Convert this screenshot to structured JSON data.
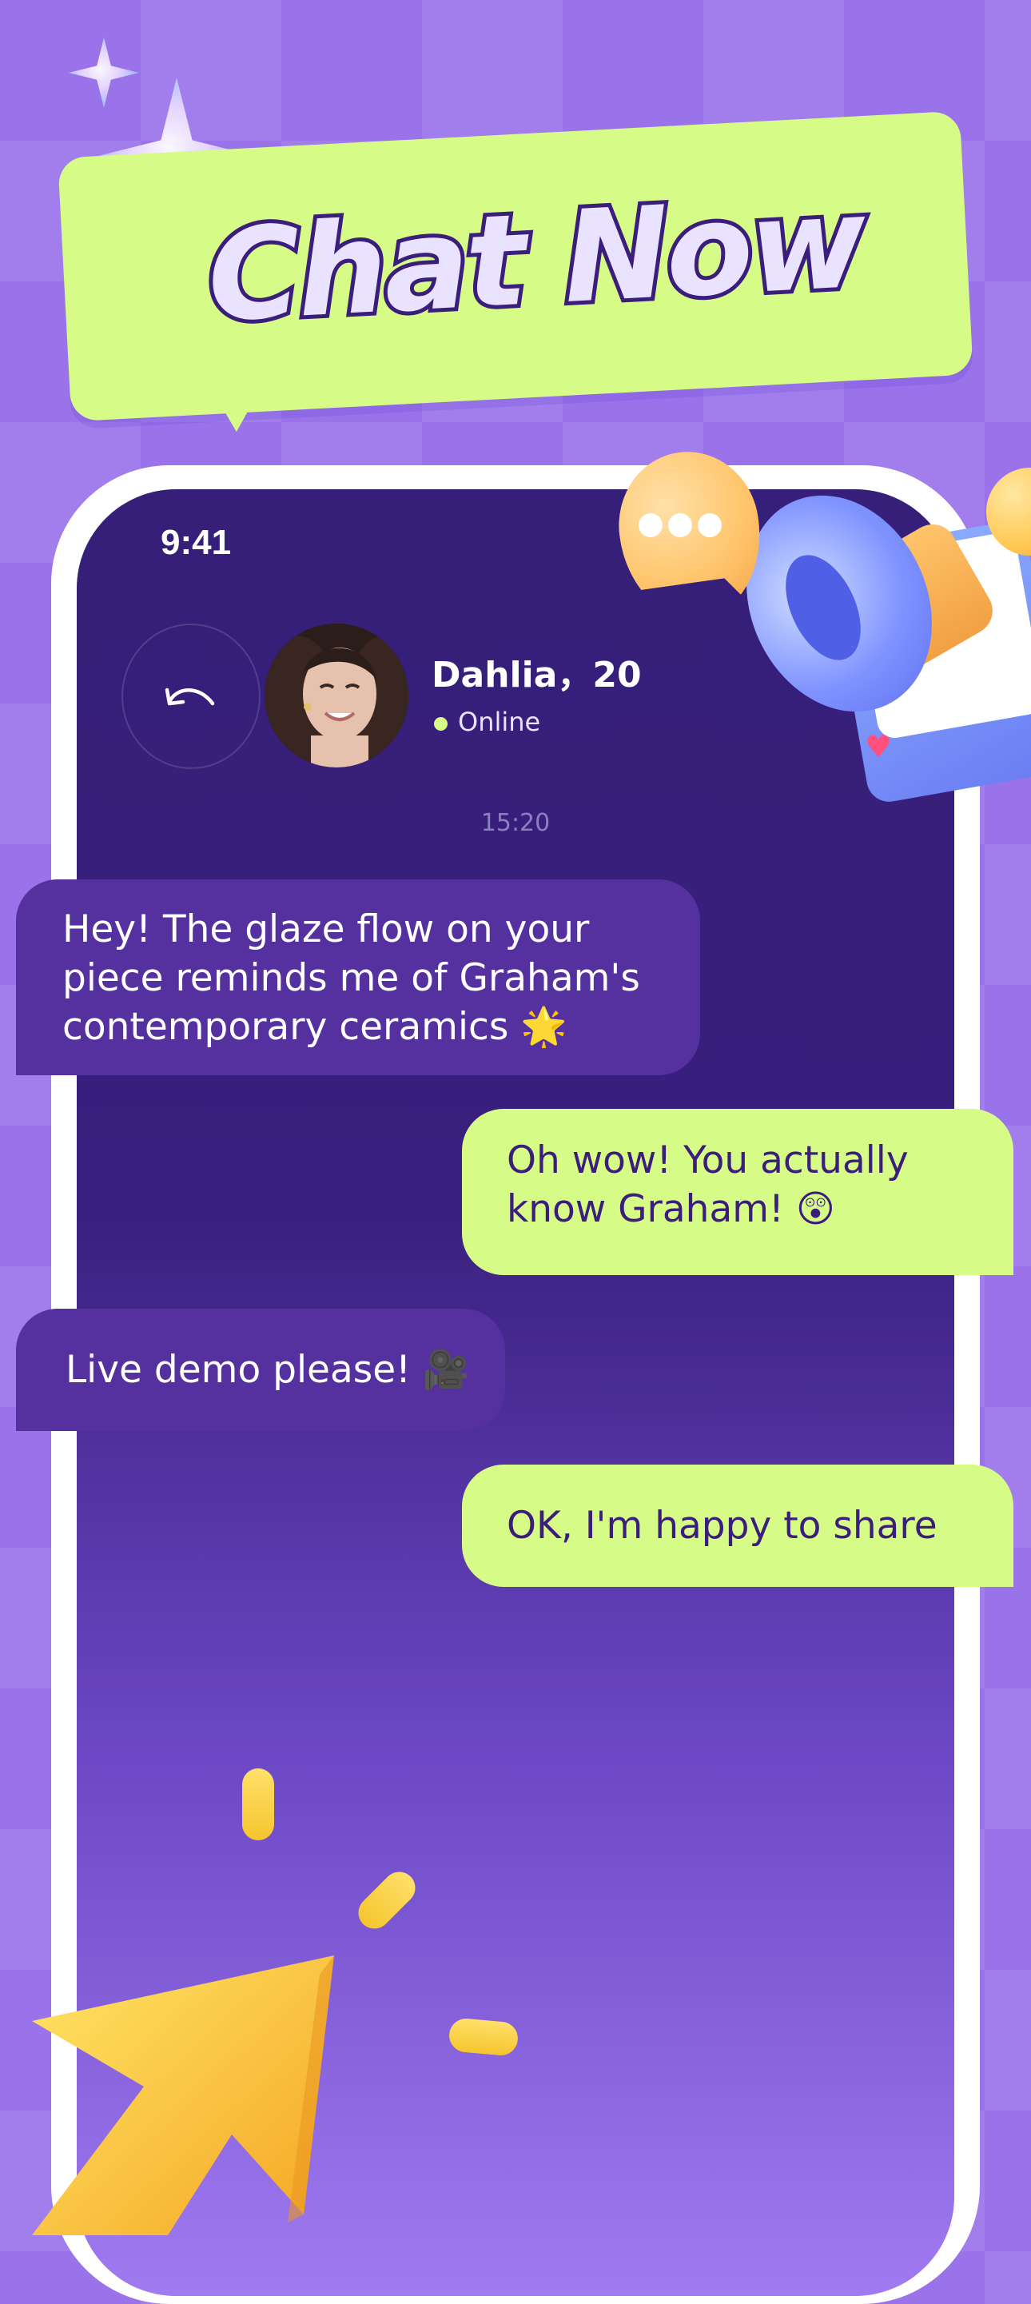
{
  "promo": {
    "headline": "Chat Now"
  },
  "status_bar": {
    "time": "9:41"
  },
  "chat_header": {
    "contact_name": "Dahlia，20",
    "status": "Online",
    "status_color": "#d6fb86"
  },
  "conversation": {
    "timestamp": "15:20",
    "messages": [
      {
        "direction": "incoming",
        "text": "Hey! The glaze flow on your piece reminds me of Graham's contemporary ceramics 🌟"
      },
      {
        "direction": "outgoing",
        "text": "Oh wow! You actually know Graham! 😲"
      },
      {
        "direction": "incoming",
        "text": "Live demo please! 🎥"
      },
      {
        "direction": "outgoing",
        "text": "OK, I'm happy to share"
      }
    ]
  },
  "icons": {
    "back": "undo-arrow-icon",
    "typing": "typing-dots-icon",
    "megaphone": "megaphone-icon",
    "cursor": "pointer-arrow-icon",
    "sparkle": "sparkle-icon"
  },
  "colors": {
    "background": "#9a72ea",
    "chat_screen": "#351f78",
    "incoming_bubble": "#55309f",
    "outgoing_bubble": "#d6fb86",
    "headline_bubble": "#d6fb86"
  }
}
